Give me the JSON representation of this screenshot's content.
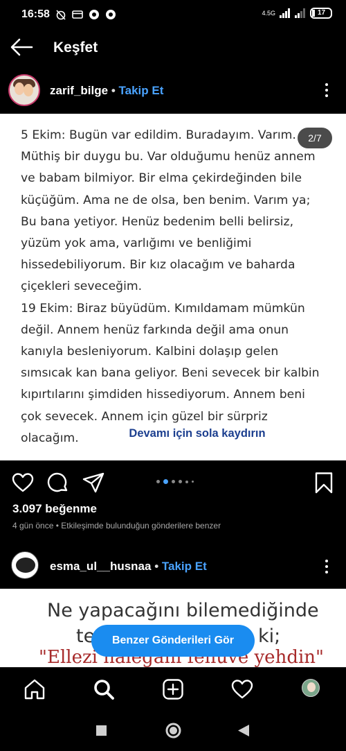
{
  "status_bar": {
    "time": "16:58",
    "network": "4.5G",
    "battery": "17"
  },
  "header": {
    "title": "Keşfet"
  },
  "post1": {
    "username": "zarif_bilge",
    "separator": "•",
    "follow_label": "Takip Et",
    "image_text_lines": [
      "5 Ekim: Bugün var edildim. Buradayım. Varım.",
      "Müthiş bir duygu bu. Var olduğumu henüz annem",
      "ve babam bilmiyor. Bir elma çekirdeğinden bile",
      "küçüğüm. Ama ne de olsa, ben benim. Varım ya;",
      "Bu bana yetiyor. Henüz bedenim belli belirsiz,",
      "yüzüm yok ama, varlığımı ve benliğimi",
      "hissedebiliyorum. Bir kız olacağım ve baharda",
      "çiçekleri seveceğim.",
      "19 Ekim: Biraz büyüdüm. Kımıldamam mümkün",
      "değil. Annem henüz farkında değil ama onun",
      "kanıyla besleniyorum. Kalbini dolaşıp gelen",
      "sımsıcak kan bana geliyor. Beni sevecek bir kalbin",
      "kıpırtılarını şimdiden hissediyorum. Annem beni",
      "çok sevecek. Annem için güzel bir sürpriz",
      "olacağım."
    ],
    "image_cta": "Devamı için sola kaydırın",
    "carousel_counter": "2/7",
    "likes": "3.097 beğenme",
    "meta": "4 gün önce • Etkileşimde bulunduğun gönderilere benzer"
  },
  "post2": {
    "username": "esma_ul__husnaa",
    "separator": "•",
    "follow_label": "Takip Et",
    "image_line1": "Ne yapacağını bilemediğinde",
    "image_line2_left": "te",
    "image_line2_right": "ki;",
    "image_line3": "\"Ellezi halegani fehuve yehdin\""
  },
  "similar_button": "Benzer Gönderileri Gör",
  "icons": {
    "back": "arrow-left-icon",
    "more": "more-vertical-icon",
    "like": "heart-icon",
    "comment": "comment-icon",
    "share": "send-icon",
    "save": "bookmark-icon",
    "home": "home-icon",
    "search": "search-icon",
    "create": "plus-square-icon",
    "activity": "heart-icon"
  },
  "colors": {
    "accent": "#4aa3ff",
    "button": "#1a8cf0",
    "cta_text": "#1c3f8f"
  }
}
